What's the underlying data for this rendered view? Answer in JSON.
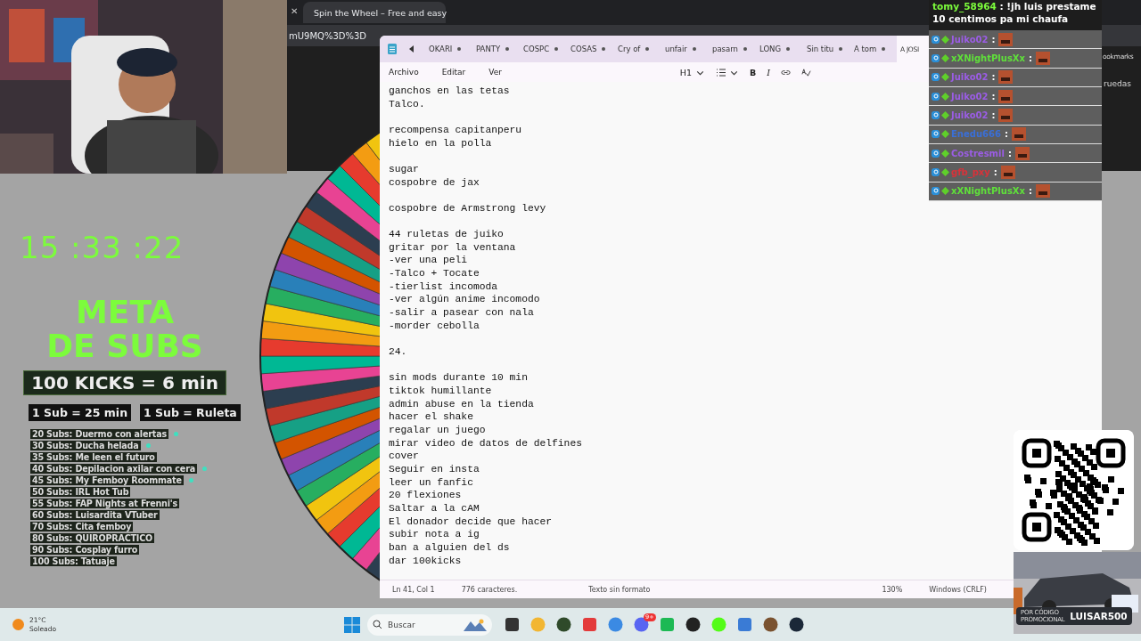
{
  "browser": {
    "close": "✕",
    "tab_title": "Spin the Wheel – Free and easy",
    "address": "mU9MQ%3D%3D",
    "fragments": [
      "ookmarks",
      "ruedas"
    ]
  },
  "overlay": {
    "clock": "15 :33 :22",
    "title": [
      "META",
      "DE SUBS"
    ],
    "kicks": "100 KICKS = 6 min",
    "rates": [
      "1 Sub = 25 min",
      "1 Sub = Ruleta"
    ],
    "goals": [
      {
        "text": "20 Subs: Duermo con alertas",
        "dot": true
      },
      {
        "text": "30 Subs: Ducha helada",
        "dot": true
      },
      {
        "text": "35 Subs: Me leen el futuro",
        "dot": false
      },
      {
        "text": "40 Subs: Depilacion axilar con cera",
        "dot": true
      },
      {
        "text": "45 Subs: My Femboy Roommate",
        "dot": true
      },
      {
        "text": "50 Subs: IRL Hot Tub",
        "dot": false
      },
      {
        "text": "55 Subs: FAP Nights at Frenni's",
        "dot": false
      },
      {
        "text": "60 Subs: Luisardita VTuber",
        "dot": false
      },
      {
        "text": "70 Subs: Cita femboy",
        "dot": false
      },
      {
        "text": "80 Subs: QUIROPRACTICO",
        "dot": false
      },
      {
        "text": "90 Subs: Cosplay furro",
        "dot": false
      },
      {
        "text": "100 Subs: Tatuaje",
        "dot": false
      }
    ]
  },
  "notepad": {
    "tabs": [
      {
        "label": "OKARI",
        "selected": false
      },
      {
        "label": "PANTY",
        "selected": false
      },
      {
        "label": "COSPC",
        "selected": false
      },
      {
        "label": "COSAS",
        "selected": false
      },
      {
        "label": "Cry of",
        "selected": false
      },
      {
        "label": "unfair",
        "selected": false
      },
      {
        "label": "pasarn",
        "selected": false
      },
      {
        "label": "LONG",
        "selected": false
      },
      {
        "label": "Sin titu",
        "selected": false
      },
      {
        "label": "A tom",
        "selected": false
      },
      {
        "label": "A JOSI",
        "selected": true
      }
    ],
    "menu": [
      "Archivo",
      "Editar",
      "Ver"
    ],
    "heading": "H1",
    "bold": "B",
    "italic": "I",
    "paragraphs": [
      [
        "ganchos en las tetas",
        "Talco."
      ],
      [
        "recompensa capitanperu",
        "hielo en la polla"
      ],
      [
        "sugar",
        "cospobre de jax"
      ],
      [
        "cospobre de Armstrong levy"
      ],
      [
        "44 ruletas de juiko",
        "gritar por la ventana",
        "-ver una peli",
        "-Talco + Tocate",
        "-tierlist incomoda",
        "-ver algún anime incomodo",
        "-salir a pasear con nala",
        "-morder cebolla"
      ],
      [
        "24."
      ],
      [
        "sin mods durante 10 min",
        "tiktok humillante",
        "admin abuse en la tienda",
        "hacer el shake",
        "regalar un juego",
        "mirar video de datos de delfines",
        "cover",
        "Seguir en insta",
        "leer un fanfic",
        "20 flexiones",
        "Saltar a la cAM",
        "El donador decide que hacer",
        "subir nota a ig",
        "ban a alguien del ds",
        "dar 100kicks"
      ]
    ],
    "status": [
      "Ln 41, Col 1",
      "776 caracteres.",
      "Texto sin formato",
      "130%",
      "Windows (CRLF)"
    ]
  },
  "chat": {
    "separator": ":",
    "top": {
      "user": "tomy_58964",
      "color": "#7cfc3c",
      "text": ": !jh luis prestame 10 centimos pa mi chaufa"
    },
    "rows": [
      {
        "user": "Juiko02",
        "color": "#9b5de5"
      },
      {
        "user": "xXNightPlusXx",
        "color": "#5fe03a"
      },
      {
        "user": "Juiko02",
        "color": "#9b5de5"
      },
      {
        "user": "Juiko02",
        "color": "#9b5de5"
      },
      {
        "user": "Juiko02",
        "color": "#9b5de5"
      },
      {
        "user": "Enedu666",
        "color": "#3a6fd8"
      },
      {
        "user": "Costresmil",
        "color": "#9b5de5"
      },
      {
        "user": "gfb_pxy",
        "color": "#d8323a"
      },
      {
        "user": "xXNightPlusXx",
        "color": "#5fe03a"
      }
    ]
  },
  "promo": {
    "label": [
      "POR CÓDIGO",
      "PROMOCIONAL"
    ],
    "code": "LUISAR500"
  },
  "taskbar": {
    "temperature": "21°C",
    "weather": "Soleado",
    "search_placeholder": "Buscar",
    "badge": "9+"
  }
}
